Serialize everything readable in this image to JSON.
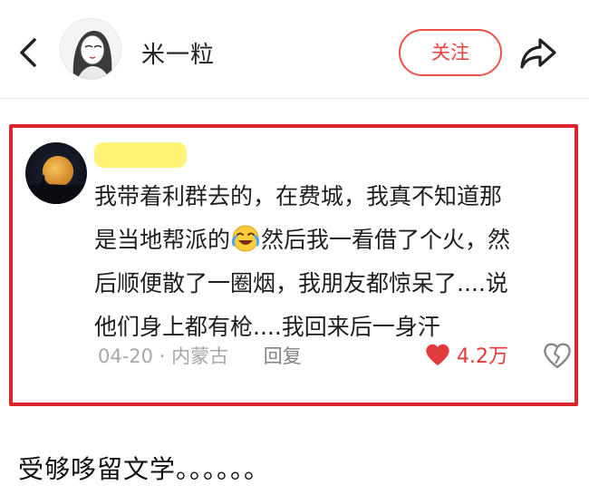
{
  "header": {
    "username": "米一粒",
    "follow_label": "关注"
  },
  "comment": {
    "author_name": "",
    "text_line1": "我带着利群去的，在费城，我真不知道那",
    "text_line2a": "是当地帮派的",
    "text_line2b": "然后我一看借了个火，然",
    "text_line3": "后顺便散了一圈烟，我朋友都惊呆了....说",
    "text_line4": "他们身上都有枪....我回来后一身汗",
    "emoji": "laughing-crying-emoji",
    "date": "04-20",
    "separator": "·",
    "location": "内蒙古",
    "reply_label": "回复",
    "likes": "4.2万",
    "highlight_color": "#d8262c",
    "like_color": "#e23b3b"
  },
  "caption": "受够哆留文学。。。。。。"
}
